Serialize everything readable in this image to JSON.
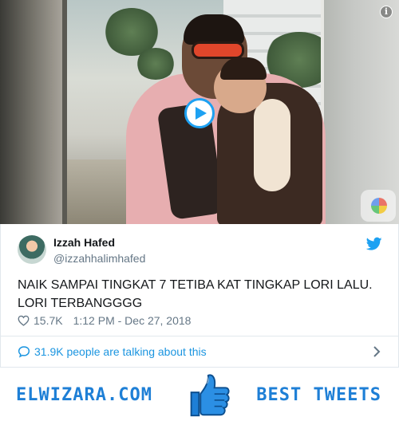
{
  "video": {
    "play_icon": "play-icon",
    "info_icon": "info-icon",
    "info_glyph": "i"
  },
  "tweet": {
    "user_name": "Izzah Hafed",
    "user_handle": "@izzahhalimhafed",
    "text": "NAIK SAMPAI TINGKAT 7 TETIBA KAT TINGKAP LORI LALU. LORI TERBANGGGG",
    "likes": "15.7K",
    "timestamp": "1:12 PM - Dec 27, 2018",
    "brand_icon": "twitter-bird-icon",
    "like_icon": "heart-icon"
  },
  "talking": {
    "label": "31.9K people are talking about this",
    "icon": "speech-bubble-icon",
    "chevron": "chevron-right-icon"
  },
  "banner": {
    "left_text": "ELWIZARA.COM",
    "right_text": "BEST TWEETS",
    "icon": "thumbs-up-icon"
  },
  "colors": {
    "twitter_blue": "#1da1f2",
    "link_blue": "#1b95e0",
    "banner_blue": "#1e7fd6",
    "secondary_text": "#657786"
  }
}
